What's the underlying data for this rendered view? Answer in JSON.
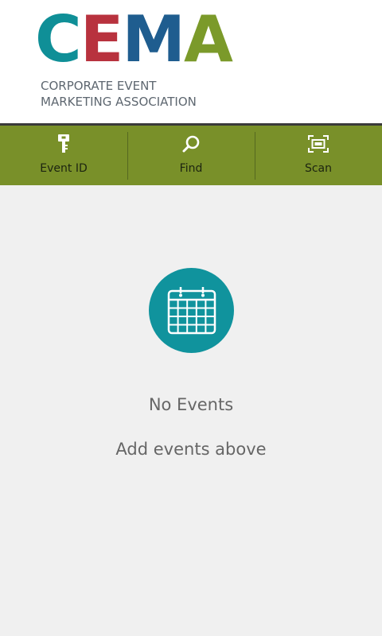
{
  "brand": {
    "letters": [
      "C",
      "E",
      "M",
      "A"
    ],
    "letter_colors": [
      "#0f8f97",
      "#b8323e",
      "#1f5d8f",
      "#7b9a2a"
    ],
    "subtitle_line1": "CORPORATE EVENT",
    "subtitle_line2": "MARKETING ASSOCIATION"
  },
  "toolbar": {
    "background": "#799029",
    "items": [
      {
        "label": "Event ID",
        "icon": "key-icon"
      },
      {
        "label": "Find",
        "icon": "search-icon"
      },
      {
        "label": "Scan",
        "icon": "scan-icon"
      }
    ]
  },
  "empty_state": {
    "icon": "calendar-icon",
    "icon_bg": "#10939d",
    "title": "No Events",
    "subtitle": "Add events above"
  }
}
